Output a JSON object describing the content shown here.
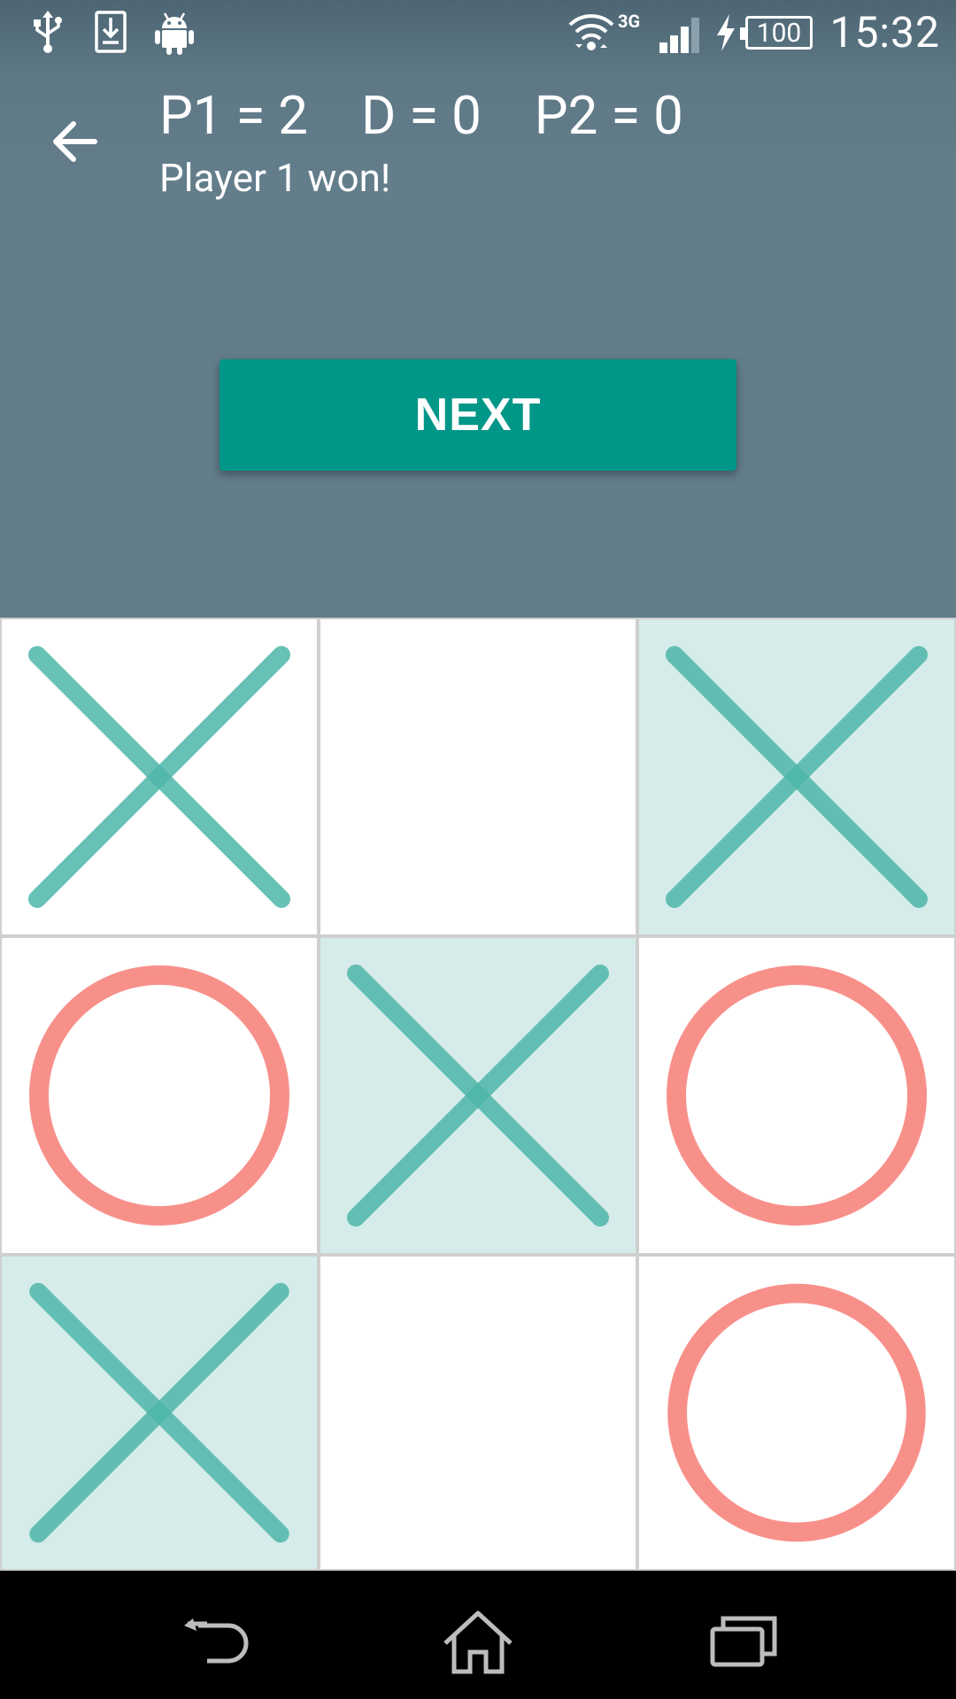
{
  "status_bar": {
    "time": "15:32",
    "network": "3G",
    "battery": "100",
    "icons": [
      "usb-icon",
      "download-icon",
      "android-icon",
      "wifi-icon",
      "signal-icon",
      "charging-icon",
      "battery-icon"
    ]
  },
  "header": {
    "score_p1": "P1 = 2",
    "score_draw": "D = 0",
    "score_p2": "P2 = 0",
    "result": "Player 1 won!",
    "next_label": "NEXT"
  },
  "colors": {
    "accent": "#009688",
    "header_bg": "#607d8b",
    "x_mark": "#4db6a8",
    "o_mark": "#f8908a",
    "win_cell": "#d5ecea"
  },
  "board": {
    "cells": [
      "X",
      "",
      "X",
      "O",
      "X",
      "O",
      "X",
      "",
      "O"
    ],
    "winning_cells": [
      2,
      4,
      6
    ]
  }
}
